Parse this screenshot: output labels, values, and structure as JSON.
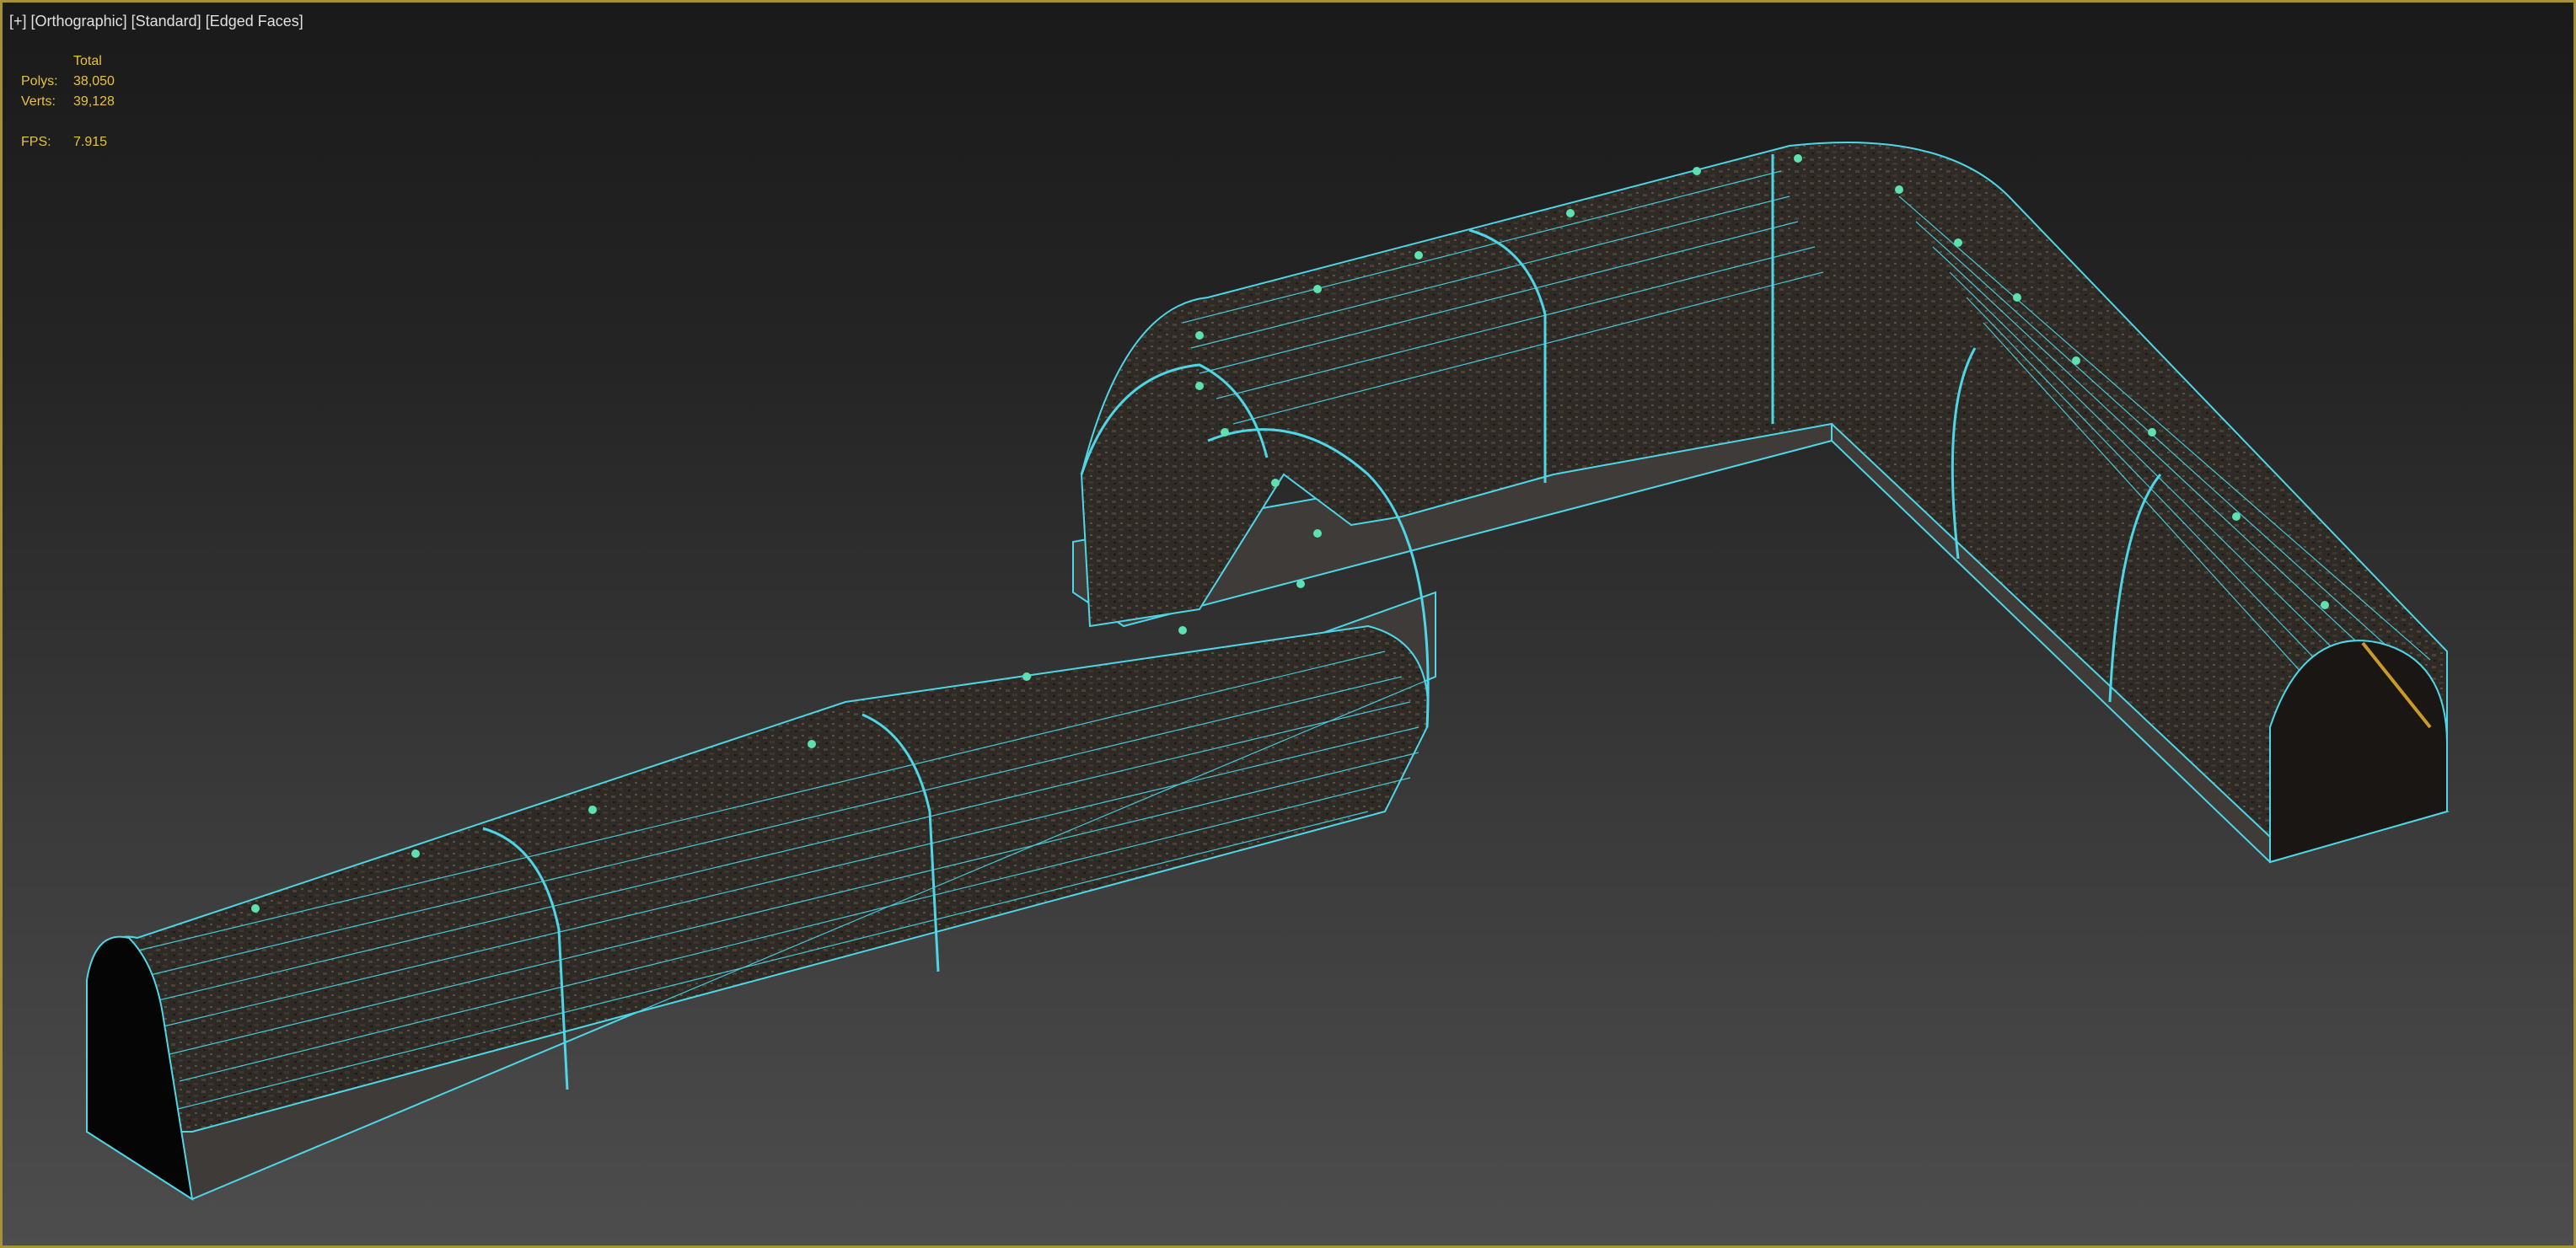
{
  "viewport": {
    "label_parts": [
      "[+]",
      "[Orthographic]",
      "[Standard]",
      "[Edged Faces]"
    ]
  },
  "stats": {
    "header": "Total",
    "polys_label": "Polys:",
    "polys_value": "38,050",
    "verts_label": "Verts:",
    "verts_value": "39,128",
    "fps_label": "FPS:",
    "fps_value": "7.915"
  },
  "colors": {
    "frame_border": "#a6903a",
    "wireframe": "#4fd6e6",
    "stats_text": "#e7c23e",
    "label_text": "#e0e0e0"
  }
}
